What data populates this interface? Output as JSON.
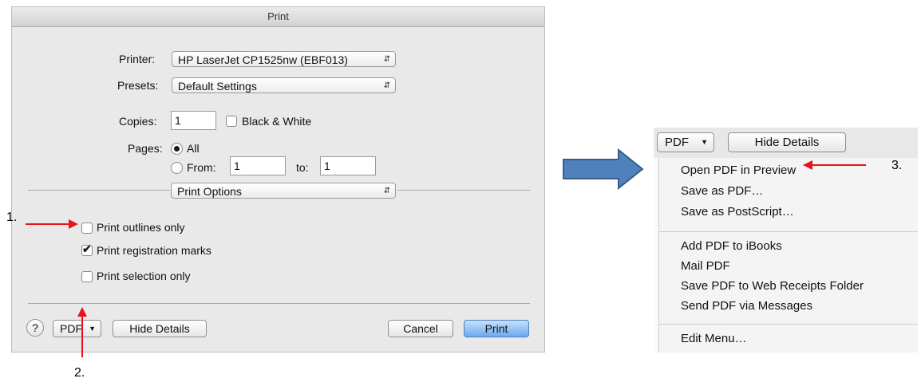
{
  "dialog": {
    "title": "Print",
    "printer": {
      "label": "Printer:",
      "value": "HP LaserJet CP1525nw (EBF013)"
    },
    "presets": {
      "label": "Presets:",
      "value": "Default Settings"
    },
    "copies": {
      "label": "Copies:",
      "value": "1",
      "bw_label": "Black & White",
      "bw_checked": false
    },
    "pages": {
      "label": "Pages:",
      "all_label": "All",
      "from_label": "From:",
      "from_value": "1",
      "to_label": "to:",
      "to_value": "1"
    },
    "section_popup": "Print Options",
    "options": [
      {
        "label": "Print outlines only",
        "checked": false
      },
      {
        "label": "Print registration marks",
        "checked": true
      },
      {
        "label": "Print selection only",
        "checked": false
      }
    ],
    "footer": {
      "help": "?",
      "pdf": "PDF",
      "hide_details": "Hide Details",
      "cancel": "Cancel",
      "print": "Print"
    }
  },
  "annotations": {
    "one": "1.",
    "two": "2.",
    "three": "3."
  },
  "pdf_menu": {
    "pdf_button": "PDF",
    "hide_details": "Hide Details",
    "items": [
      "Open PDF in Preview",
      "Save as PDF…",
      "Save as PostScript…",
      "Add PDF to iBooks",
      "Mail PDF",
      "Save PDF to Web Receipts Folder",
      "Send PDF via Messages",
      "Edit Menu…"
    ]
  },
  "colors": {
    "arrow_red": "#e8141a",
    "big_arrow_blue": "#4f81bd",
    "print_button_blue": "#6aa9f0"
  }
}
